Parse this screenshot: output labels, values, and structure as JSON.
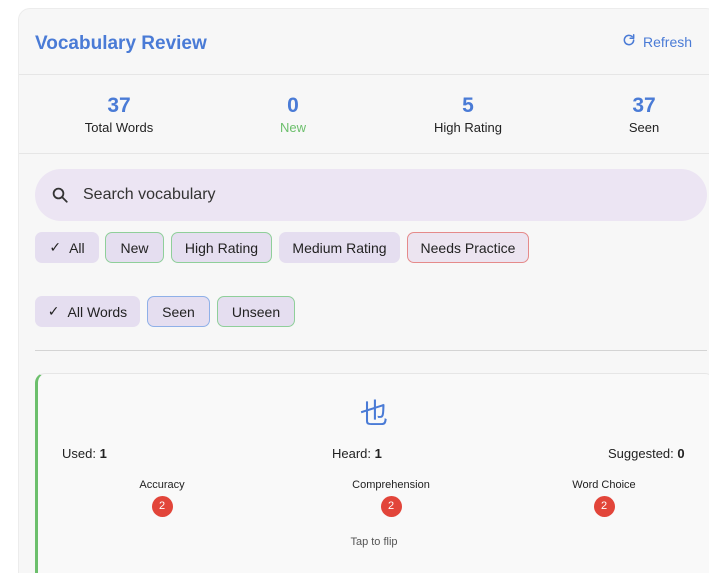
{
  "header": {
    "title": "Vocabulary Review",
    "refresh_label": "Refresh"
  },
  "stats": [
    {
      "value": "37",
      "label": "Total Words"
    },
    {
      "value": "0",
      "label": "New"
    },
    {
      "value": "5",
      "label": "High Rating"
    },
    {
      "value": "37",
      "label": "Seen"
    }
  ],
  "search": {
    "placeholder": "Search vocabulary",
    "value": ""
  },
  "rating_filters": [
    {
      "label": "All",
      "selected": true
    },
    {
      "label": "New",
      "selected": false
    },
    {
      "label": "High Rating",
      "selected": false
    },
    {
      "label": "Medium Rating",
      "selected": false
    },
    {
      "label": "Needs Practice",
      "selected": false
    }
  ],
  "seen_filters": [
    {
      "label": "All Words",
      "selected": true
    },
    {
      "label": "Seen",
      "selected": false
    },
    {
      "label": "Unseen",
      "selected": false
    }
  ],
  "card": {
    "character": "也",
    "used_label": "Used:",
    "used_value": "1",
    "heard_label": "Heard:",
    "heard_value": "1",
    "suggested_label": "Suggested:",
    "suggested_value": "0",
    "ratings": [
      {
        "label": "Accuracy",
        "value": "2"
      },
      {
        "label": "Comprehension",
        "value": "2"
      },
      {
        "label": "Word Choice",
        "value": "2"
      }
    ],
    "hint": "Tap to flip"
  },
  "colors": {
    "accent": "#4a7bd6",
    "new_green": "#6cbf6c",
    "badge_red": "#e2453a",
    "chip_bg": "#e5def0"
  }
}
